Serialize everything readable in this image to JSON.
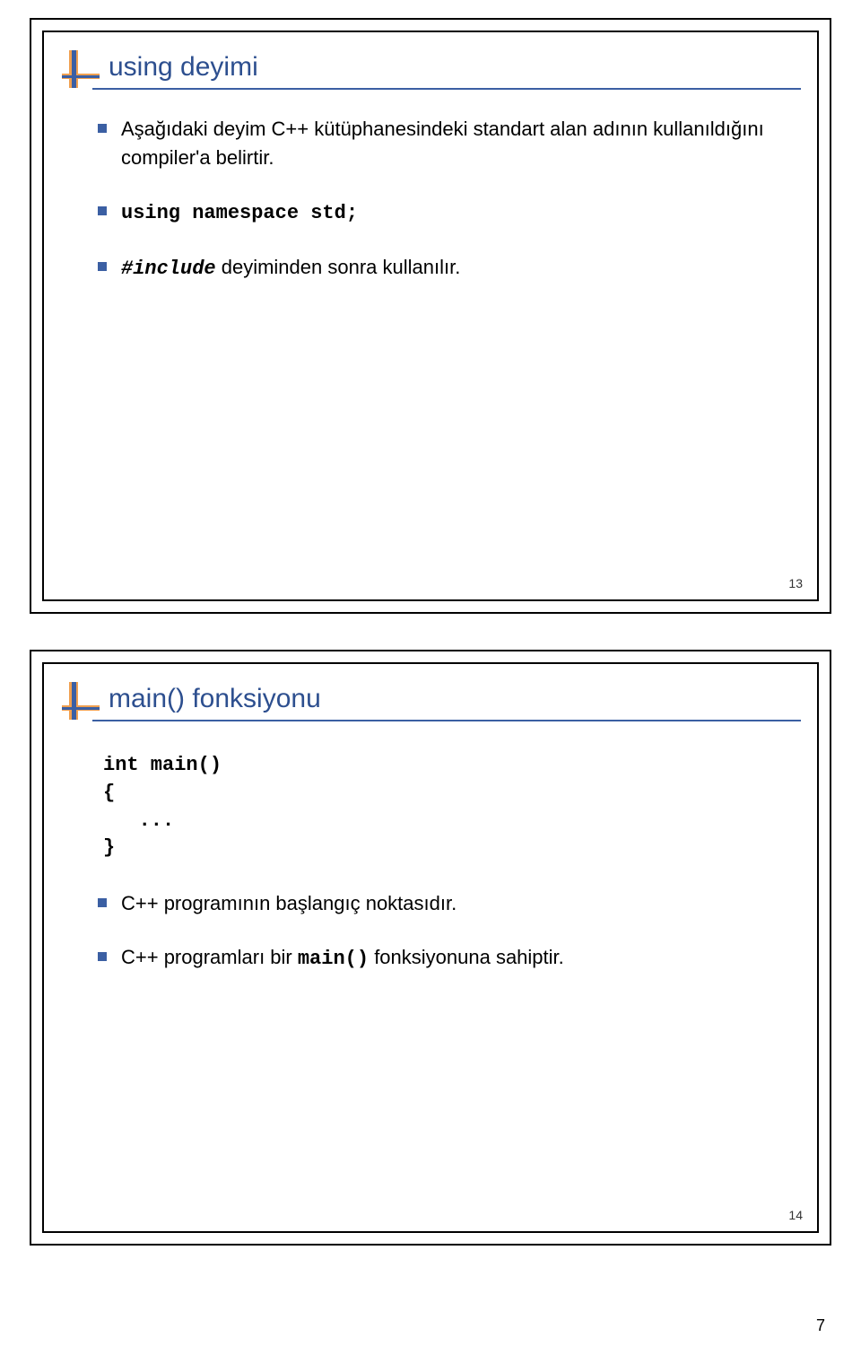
{
  "slide1": {
    "title": "using deyimi",
    "bullets": [
      {
        "text": "Aşağıdaki deyim C++ kütüphanesindeki standart alan adının kullanıldığını compiler'a belirtir."
      },
      {
        "code": "using namespace std;"
      },
      {
        "prefix_code": "#include",
        "suffix_text": "  deyiminden sonra kullanılır."
      }
    ],
    "num": "13"
  },
  "slide2": {
    "title": "main() fonksiyonu",
    "code_lines": "int main()\n{\n   ...\n}",
    "bullets": [
      {
        "text": "C++ programının başlangıç noktasıdır."
      },
      {
        "prefix_text": "C++ programları bir ",
        "code": "main()",
        "suffix_text": " fonksiyonuna sahiptir."
      }
    ],
    "num": "14"
  },
  "page_num": "7"
}
